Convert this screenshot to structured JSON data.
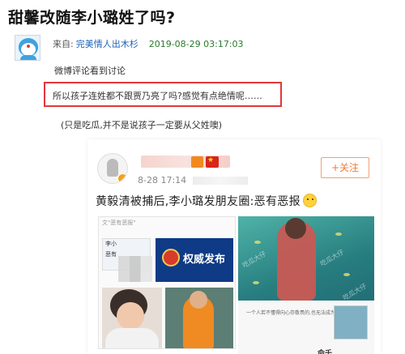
{
  "title": "甜馨改随李小璐姓了吗?",
  "author": {
    "source_prefix": "来自:",
    "source_name": "完美情人出木杉",
    "datetime": "2019-08-29 03:17:03"
  },
  "comments": {
    "line1": "微博评论看到讨论",
    "highlighted": "所以孩子连姓都不跟贾乃亮了吗?感觉有点绝情呢……",
    "line3": "(只是吃瓜,并不是说孩子一定要从父姓噢)"
  },
  "embedded_post": {
    "time": "8-28 17:14",
    "follow_label": "+关注",
    "headline": "黄毅清被捕后,李小璐发朋友圈:恶有恶报",
    "image_left": {
      "tag": "文\"恶有恶报\"",
      "card_lines": [
        "李小",
        "恶有"
      ],
      "official_text": "权威发布"
    },
    "image_right": {
      "watermark": "吃瓜大仔",
      "caption": "一个人若不懂得向心存敬畏的,也无法成为一个..",
      "bottom_text": "命千"
    }
  },
  "colors": {
    "highlight_border": "#e0373a",
    "link_blue": "#1e62b8",
    "date_green": "#2b7a2b",
    "follow_orange": "#f07a3a"
  }
}
